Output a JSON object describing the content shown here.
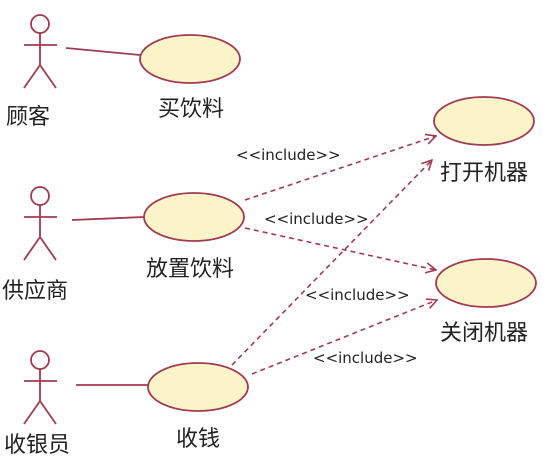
{
  "colors": {
    "line": "#a23a52",
    "ellipse_fill": "#fbf4c8",
    "ellipse_stroke": "#a23a52",
    "text": "#222222"
  },
  "actors": [
    {
      "id": "customer",
      "label": "顾客"
    },
    {
      "id": "supplier",
      "label": "供应商"
    },
    {
      "id": "cashier",
      "label": "收银员"
    }
  ],
  "use_cases": [
    {
      "id": "buy-drink",
      "label": "买饮料"
    },
    {
      "id": "stock-drink",
      "label": "放置饮料"
    },
    {
      "id": "collect-money",
      "label": "收钱"
    },
    {
      "id": "open-machine",
      "label": "打开机器"
    },
    {
      "id": "close-machine",
      "label": "关闭机器"
    }
  ],
  "associations": [
    {
      "from": "customer",
      "to": "buy-drink"
    },
    {
      "from": "supplier",
      "to": "stock-drink"
    },
    {
      "from": "cashier",
      "to": "collect-money"
    }
  ],
  "includes": [
    {
      "from": "stock-drink",
      "to": "open-machine",
      "label": "<<include>>"
    },
    {
      "from": "stock-drink",
      "to": "close-machine",
      "label": "<<include>>"
    },
    {
      "from": "collect-money",
      "to": "open-machine",
      "label": "<<include>>"
    },
    {
      "from": "collect-money",
      "to": "close-machine",
      "label": "<<include>>"
    }
  ]
}
